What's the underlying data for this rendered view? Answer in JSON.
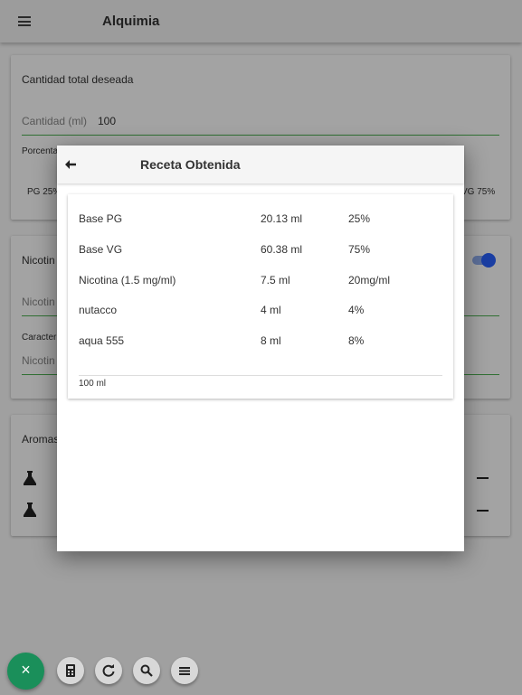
{
  "app": {
    "title": "Alquimia"
  },
  "background": {
    "total_label": "Cantidad total deseada",
    "cantidad_label": "Cantidad (ml)",
    "cantidad_value": "100",
    "porcentaje_label_partial": "Porcenta",
    "pg_label_partial": "PG 25%",
    "vg_label_partial": "VG 75%",
    "nicotina_label_partial": "Nicotin",
    "nicotina_field_partial": "Nicotin",
    "caracteristicas_partial": "Caracter",
    "nicotina_field2_partial": "Nicotin",
    "aromas_partial": "Aromas"
  },
  "dialog": {
    "title": "Receta Obtenida",
    "rows": [
      {
        "name": "Base PG",
        "amount": "20.13 ml",
        "percent": "25%"
      },
      {
        "name": "Base VG",
        "amount": "60.38 ml",
        "percent": "75%"
      },
      {
        "name": "Nicotina (1.5 mg/ml)",
        "amount": "7.5 ml",
        "percent": "20mg/ml"
      },
      {
        "name": "nutacco",
        "amount": "4 ml",
        "percent": "4%"
      },
      {
        "name": "aqua 555",
        "amount": "8 ml",
        "percent": "8%"
      }
    ],
    "total": "100 ml"
  },
  "fab": {
    "main_symbol": "×"
  },
  "icons": [
    "menu-icon",
    "back-arrow-icon",
    "flask-icon",
    "calculator-icon",
    "refresh-icon",
    "search-icon",
    "list-icon",
    "close-icon"
  ],
  "colors": {
    "accent_green": "#1a8f5a",
    "toggle_blue": "#2962ff",
    "underline_green": "#4caf50"
  }
}
